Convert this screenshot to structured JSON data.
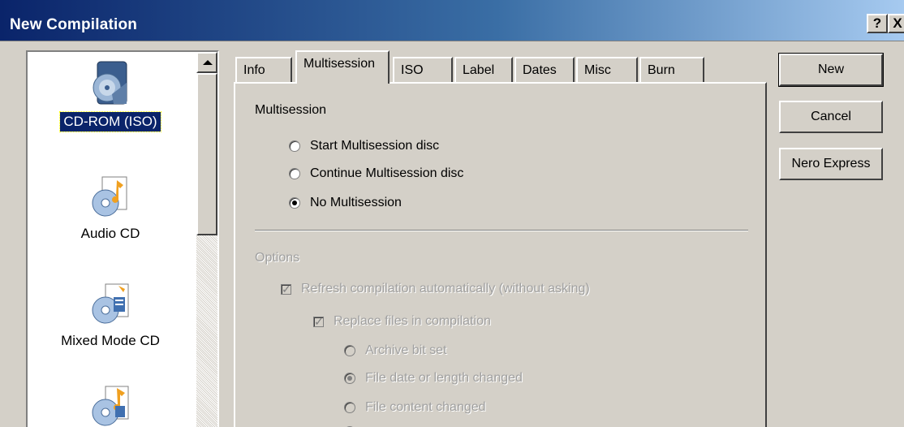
{
  "window": {
    "title": "New Compilation",
    "help_label": "?",
    "close_label": "X"
  },
  "compilation_list": {
    "items": [
      {
        "label": "CD-ROM (ISO)",
        "icon": "cd-rom-iso-icon",
        "selected": true
      },
      {
        "label": "Audio CD",
        "icon": "audio-cd-icon",
        "selected": false
      },
      {
        "label": "Mixed Mode CD",
        "icon": "mixed-mode-cd-icon",
        "selected": false
      },
      {
        "label": "",
        "icon": "cd-extra-icon",
        "selected": false
      }
    ]
  },
  "tabs": [
    {
      "label": "Info",
      "active": false
    },
    {
      "label": "Multisession",
      "active": true
    },
    {
      "label": "ISO",
      "active": false
    },
    {
      "label": "Label",
      "active": false
    },
    {
      "label": "Dates",
      "active": false
    },
    {
      "label": "Misc",
      "active": false
    },
    {
      "label": "Burn",
      "active": false
    }
  ],
  "multisession": {
    "group_label": "Multisession",
    "options": [
      {
        "label": "Start Multisession disc",
        "checked": false
      },
      {
        "label": "Continue Multisession disc",
        "checked": false
      },
      {
        "label": "No Multisession",
        "checked": true
      }
    ]
  },
  "options": {
    "group_label": "Options",
    "refresh_label": "Refresh compilation automatically (without asking)",
    "refresh_checked": true,
    "replace_label": "Replace files in compilation",
    "replace_checked": true,
    "replace_options": [
      {
        "label": "Archive bit set",
        "checked": false
      },
      {
        "label": "File date or length changed",
        "checked": true
      },
      {
        "label": "File content changed",
        "checked": false
      }
    ]
  },
  "buttons": {
    "new_label": "New",
    "cancel_label": "Cancel",
    "nero_express_label": "Nero Express"
  },
  "colors": {
    "title_gradient_start": "#0a246a",
    "title_gradient_end": "#a6caf0",
    "face": "#d4d0c8",
    "selection": "#0a246a",
    "disabled_text": "#a0a0a0"
  }
}
